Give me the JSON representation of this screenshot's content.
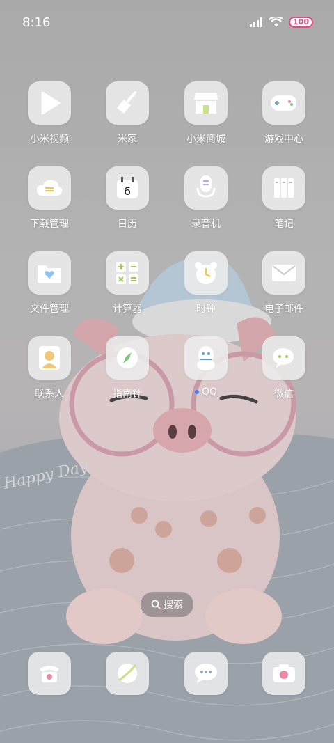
{
  "status": {
    "time": "8:16",
    "battery": "100"
  },
  "apps": [
    {
      "label": "小米视频",
      "icon": "play-icon"
    },
    {
      "label": "米家",
      "icon": "broom-icon"
    },
    {
      "label": "小米商城",
      "icon": "store-icon"
    },
    {
      "label": "游戏中心",
      "icon": "gamepad-icon"
    },
    {
      "label": "下载管理",
      "icon": "cloud-download-icon"
    },
    {
      "label": "日历",
      "icon": "calendar-icon",
      "calendar_day": "6"
    },
    {
      "label": "录音机",
      "icon": "microphone-icon"
    },
    {
      "label": "笔记",
      "icon": "notes-icon"
    },
    {
      "label": "文件管理",
      "icon": "folder-heart-icon"
    },
    {
      "label": "计算器",
      "icon": "calculator-icon"
    },
    {
      "label": "时钟",
      "icon": "alarm-clock-icon"
    },
    {
      "label": "电子邮件",
      "icon": "envelope-icon"
    },
    {
      "label": "联系人",
      "icon": "contact-person-icon"
    },
    {
      "label": "指南针",
      "icon": "compass-icon"
    },
    {
      "label": "QQ",
      "icon": "qq-penguin-icon",
      "has_dot": true
    },
    {
      "label": "微信",
      "icon": "wechat-icon"
    }
  ],
  "search": {
    "label": "搜索"
  },
  "dock": [
    {
      "icon": "phone-icon"
    },
    {
      "icon": "browser-icon"
    },
    {
      "icon": "message-icon"
    },
    {
      "icon": "camera-icon"
    }
  ],
  "wallpaper": {
    "text": "Happy Day"
  }
}
